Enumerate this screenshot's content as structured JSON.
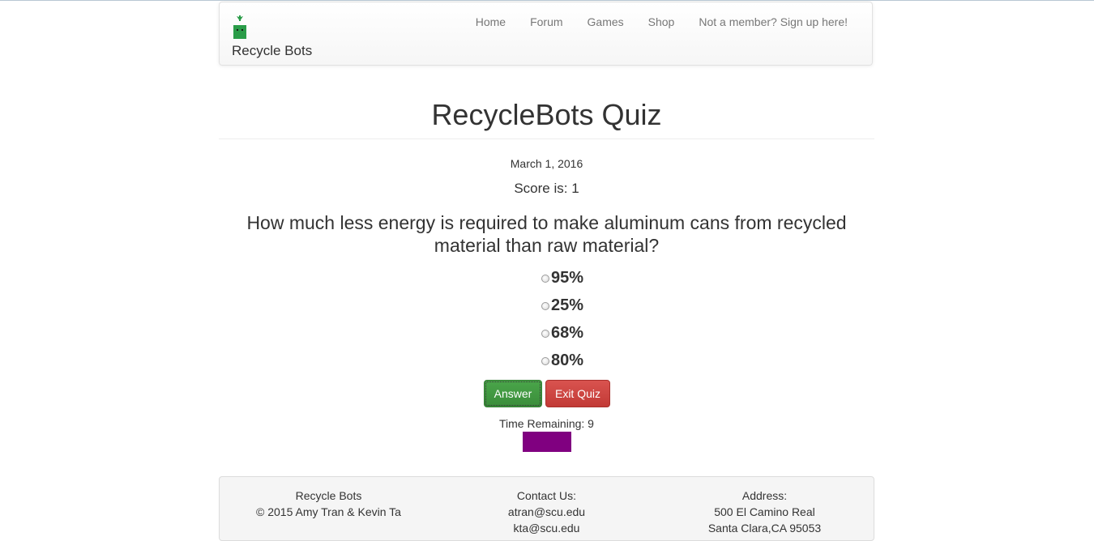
{
  "nav": {
    "brand": "Recycle Bots",
    "links": [
      "Home",
      "Forum",
      "Games",
      "Shop",
      "Not a member? Sign up here!"
    ]
  },
  "quiz": {
    "title": "RecycleBots Quiz",
    "date": "March 1, 2016",
    "score": "Score is: 1",
    "question": "How much less energy is required to make aluminum cans from recycled material than raw material?",
    "options": [
      "95%",
      "25%",
      "68%",
      "80%"
    ],
    "answer_label": "Answer",
    "exit_label": "Exit Quiz",
    "time_remaining": "Time Remaining: 9",
    "time_fraction": 0.9
  },
  "footer": {
    "col1": [
      "Recycle Bots",
      "© 2015 Amy Tran & Kevin Ta"
    ],
    "col2": [
      "Contact Us:",
      "atran@scu.edu",
      "kta@scu.edu"
    ],
    "col3": [
      "Address:",
      "500 El Camino Real",
      "Santa Clara,CA 95053"
    ]
  },
  "colors": {
    "brand_green": "#2a9c48",
    "answer_green": "#449d44",
    "exit_red": "#d9534f",
    "timer_purple": "#800080"
  }
}
